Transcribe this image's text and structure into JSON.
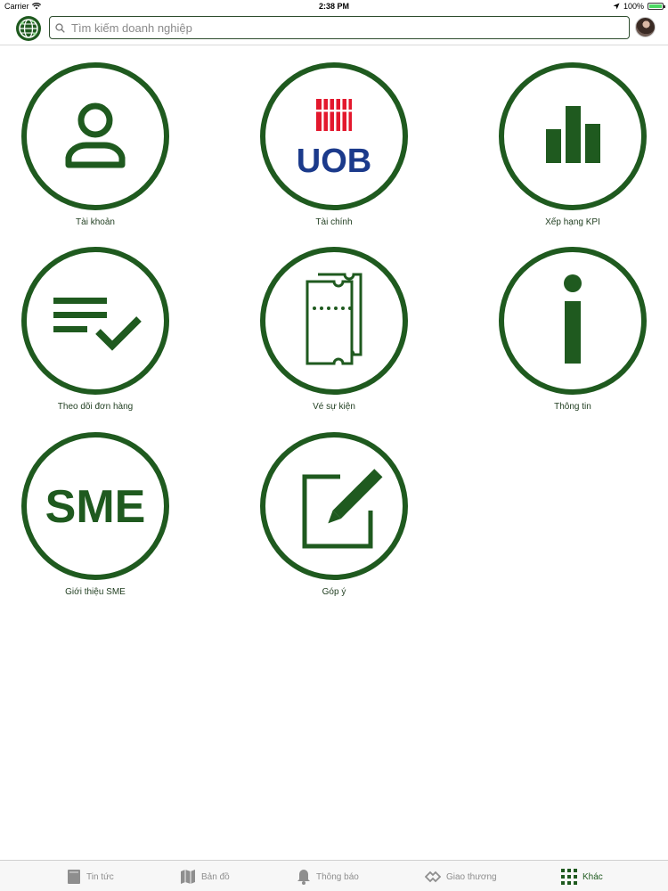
{
  "status_bar": {
    "carrier": "Carrier",
    "time": "2:38 PM",
    "battery": "100%",
    "battery_level": 1.0
  },
  "header": {
    "search_placeholder": "Tìm kiếm doanh nghiệp",
    "logo_icon": "globe-logo-icon",
    "avatar_icon": "user-avatar"
  },
  "tiles": [
    {
      "label": "Tài khoản",
      "icon": "user-icon"
    },
    {
      "label": "Tài chính",
      "icon": "uob-logo-icon",
      "logo_text": "UOB"
    },
    {
      "label": "Xếp hạng KPI",
      "icon": "bar-chart-icon"
    },
    {
      "label": "Theo dõi đơn hàng",
      "icon": "checklist-icon"
    },
    {
      "label": "Vé sự kiện",
      "icon": "ticket-icon"
    },
    {
      "label": "Thông tin",
      "icon": "info-icon"
    },
    {
      "label": "Giới thiệu SME",
      "icon": "sme-icon",
      "logo_text": "SME"
    },
    {
      "label": "Góp ý",
      "icon": "edit-icon"
    }
  ],
  "tab_bar": {
    "items": [
      {
        "label": "Tin tức",
        "icon": "news-icon"
      },
      {
        "label": "Bản đồ",
        "icon": "map-icon"
      },
      {
        "label": "Thông báo",
        "icon": "bell-icon"
      },
      {
        "label": "Giao thương",
        "icon": "handshake-icon"
      },
      {
        "label": "Khác",
        "icon": "grid-icon"
      }
    ],
    "active_index": 4
  },
  "colors": {
    "accent_green": "#1f5a1f",
    "uob_red": "#e3182d",
    "uob_blue": "#1b3a8b"
  }
}
